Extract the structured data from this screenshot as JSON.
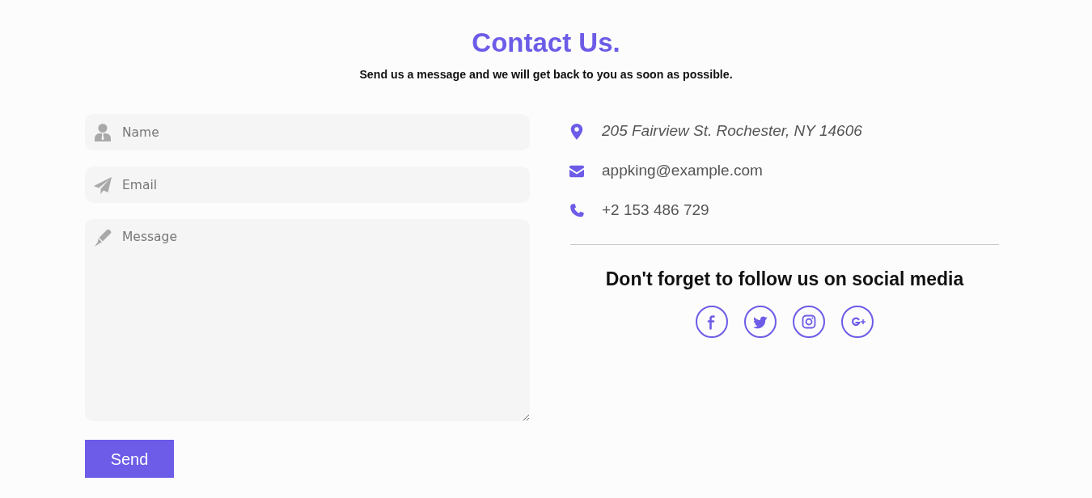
{
  "header": {
    "title": "Contact Us.",
    "subtitle": "Send us a message and we will get back to you as soon as possible."
  },
  "form": {
    "fields": [
      {
        "kind": "name",
        "placeholder": "Name"
      },
      {
        "kind": "email",
        "placeholder": "Email"
      },
      {
        "kind": "message",
        "placeholder": "Message"
      }
    ],
    "submit": "Send"
  },
  "contact_items": [
    {
      "kind": "address",
      "text": "205 Fairview St. Rochester, NY 14606"
    },
    {
      "kind": "email",
      "text": "appking@example.com"
    },
    {
      "kind": "phone",
      "text": "+2 153 486 729"
    }
  ],
  "social": {
    "heading": "Don't forget to follow us on social media",
    "links": [
      {
        "kind": "facebook"
      },
      {
        "kind": "twitter"
      },
      {
        "kind": "instagram"
      },
      {
        "kind": "google-plus"
      }
    ]
  }
}
